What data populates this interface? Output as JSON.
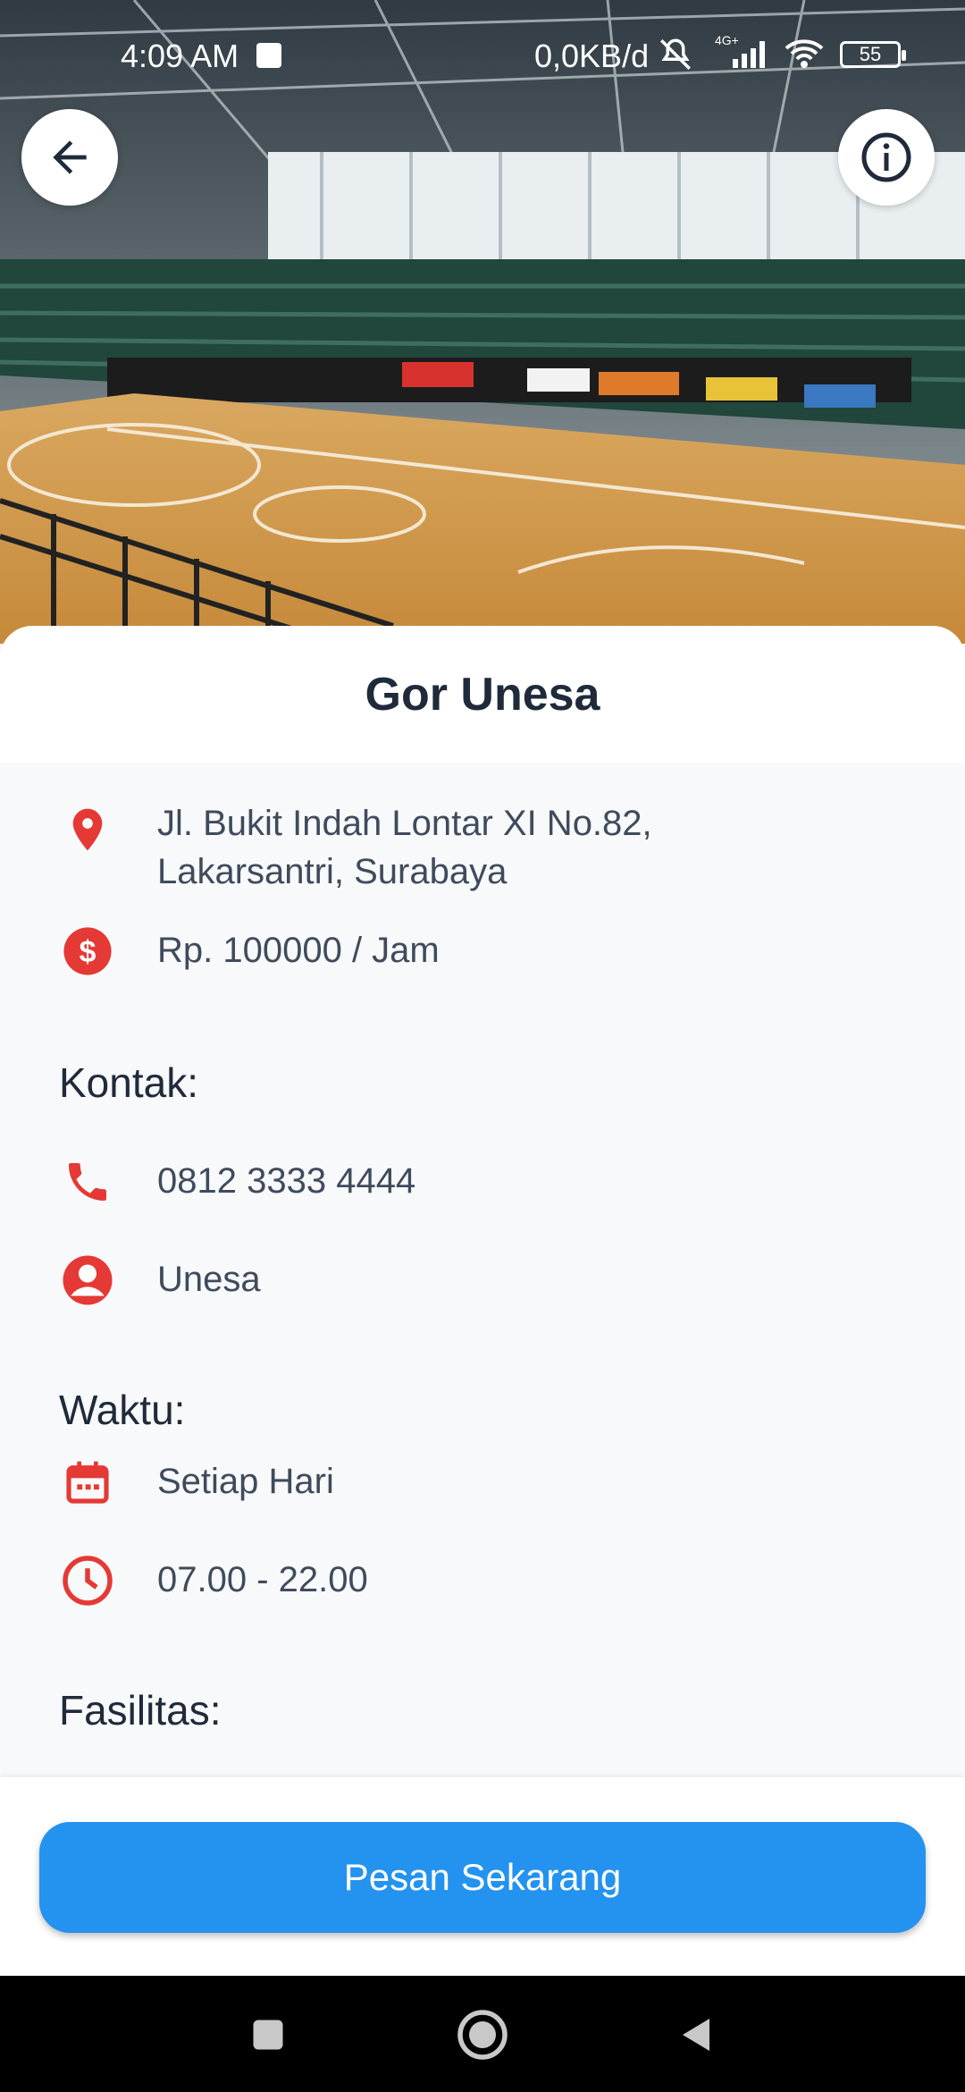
{
  "status_bar": {
    "time": "4:09 AM",
    "network_speed": "0,0KB/d",
    "signal_label": "4G+",
    "battery": "55"
  },
  "hero": {
    "back_icon": "arrow-left-icon",
    "info_icon": "info-icon"
  },
  "venue": {
    "name": "Gor Unesa",
    "address_line1": "Jl. Bukit Indah Lontar XI No.82,",
    "address_line2": "Lakarsantri, Surabaya",
    "price": "Rp. 100000 / Jam"
  },
  "contact": {
    "label": "Kontak:",
    "phone": "0812 3333 4444",
    "person": "Unesa"
  },
  "schedule": {
    "label": "Waktu:",
    "days": "Setiap Hari",
    "hours": "07.00 - 22.00"
  },
  "facilities": {
    "label": "Fasilitas:"
  },
  "cta": {
    "label": "Pesan Sekarang"
  },
  "colors": {
    "accent_red": "#e53935",
    "primary_blue": "#2492ef"
  }
}
